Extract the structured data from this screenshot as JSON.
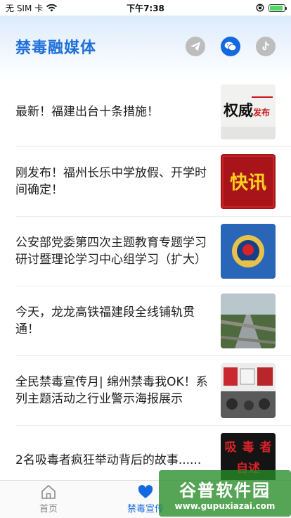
{
  "status_bar": {
    "carrier": "无 SIM 卡",
    "time": "下午7:38",
    "battery_level": 0.9,
    "battery_color": "#4cd964"
  },
  "header": {
    "title": "禁毒融媒体",
    "icons": [
      "telegram-icon",
      "wechat-icon",
      "tiktok-icon"
    ]
  },
  "news": [
    {
      "title": "最新！福建出台十条措施！",
      "thumb": "权威发布"
    },
    {
      "title": "刚发布！福州长乐中学放假、开学时间确定！",
      "thumb": "快讯"
    },
    {
      "title": "公安部党委第四次主题教育专题学习研讨暨理论学习中心组学习（扩大）",
      "thumb": "police-emblem"
    },
    {
      "title": "今天，龙龙高铁福建段全线铺轨贯通！",
      "thumb": "railway"
    },
    {
      "title": "全民禁毒宣传月| 绵州禁毒我OK！系列主题活动之行业警示海报展示",
      "thumb": "poster"
    },
    {
      "title": "2名吸毒者疯狂举动背后的故事......",
      "thumb": "吸毒者自述"
    }
  ],
  "tabs": [
    {
      "label": "首页",
      "icon": "home-icon",
      "active": false
    },
    {
      "label": "禁毒宣传",
      "icon": "heart-icon",
      "active": true
    }
  ],
  "watermark": {
    "title": "谷普软件园",
    "url": "www.gupuxiazai.com"
  },
  "colors": {
    "accent": "#1469e0",
    "title_blue": "#1f6fd8"
  }
}
